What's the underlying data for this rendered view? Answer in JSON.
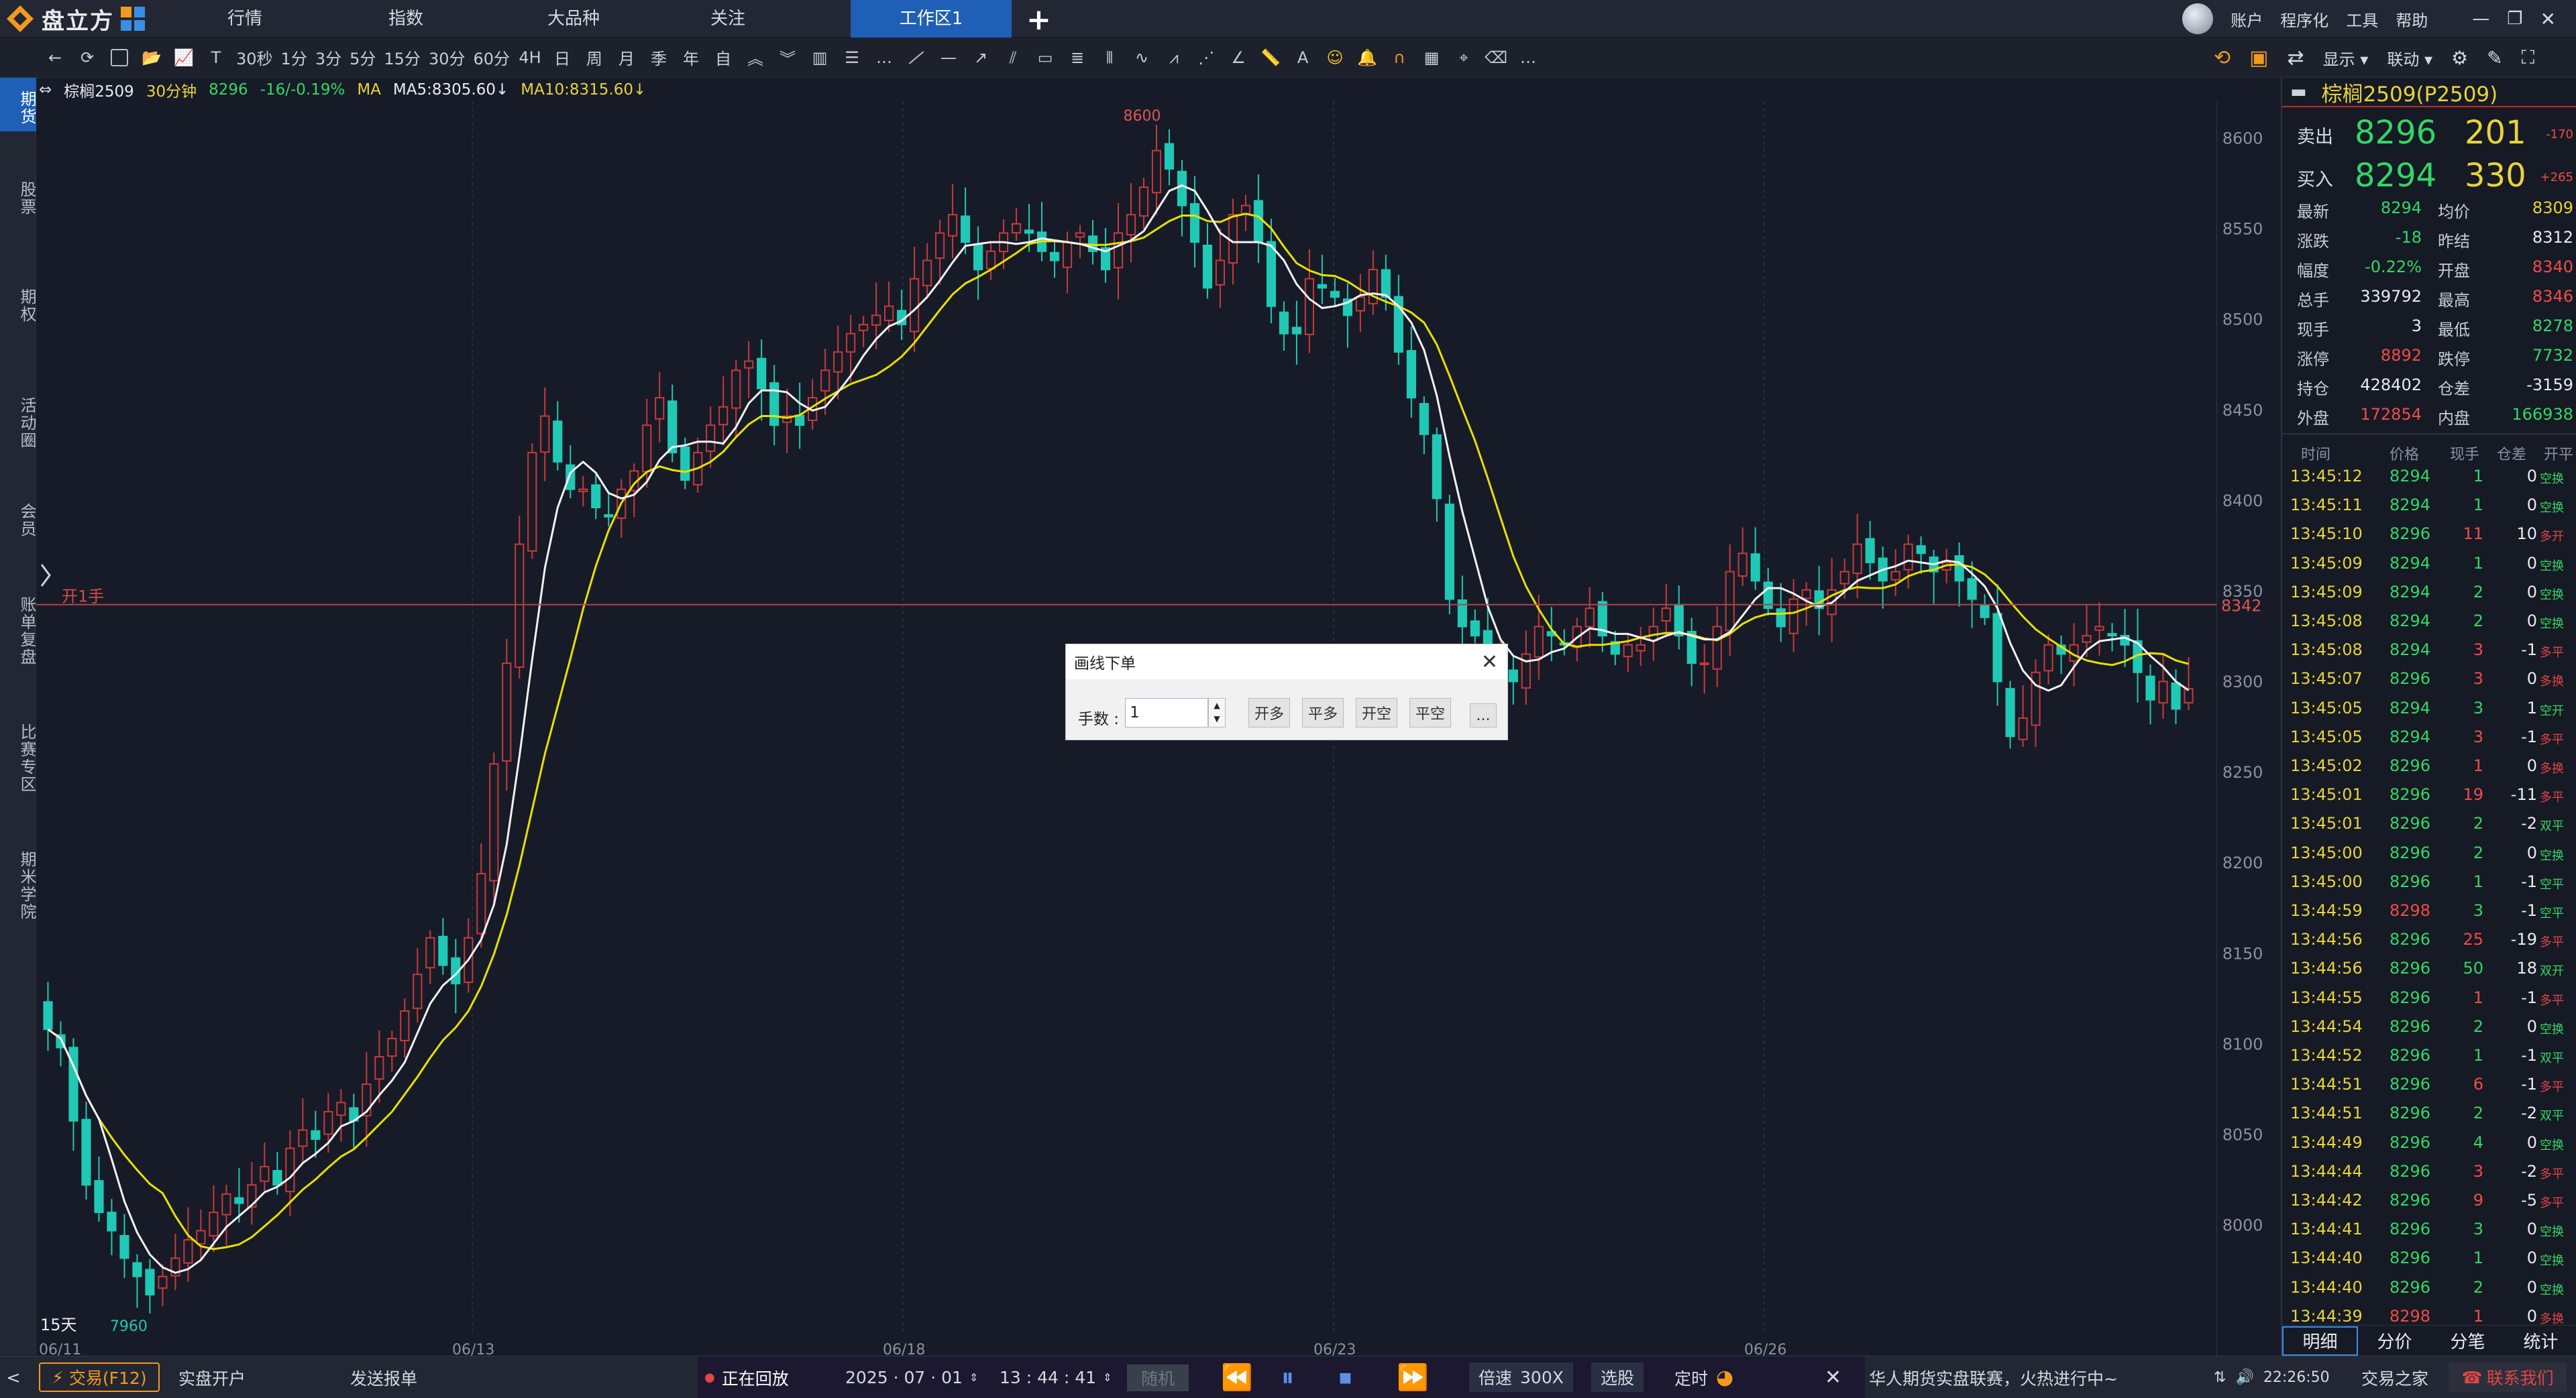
{
  "app": {
    "logo_text": "盘立方"
  },
  "nav": {
    "tabs": [
      "行情",
      "指数",
      "大品种",
      "关注",
      "工作区1"
    ],
    "right": [
      "账户",
      "程序化",
      "工具",
      "帮助"
    ]
  },
  "toolbar": {
    "periods": [
      "30秒",
      "1分",
      "3分",
      "5分",
      "15分",
      "30分",
      "60分",
      "4H",
      "日",
      "周",
      "月",
      "季",
      "年",
      "自"
    ]
  },
  "sidebar": {
    "items": [
      "期货",
      "股票",
      "期权",
      "活动圈",
      "会员",
      "账单复盘",
      "比赛专区",
      "期米学院"
    ]
  },
  "chartinfo": {
    "symbol": "棕榈2509",
    "period": "30分钟",
    "price": "8296",
    "change": "-16/-0.19%",
    "ma_label": "MA",
    "ma5": "MA5:8305.60↓",
    "ma10": "MA10:8315.60↓"
  },
  "chart": {
    "ylabels": [
      "8600",
      "8550",
      "8500",
      "8450",
      "8400",
      "8350",
      "8300",
      "8250",
      "8200",
      "8150",
      "8100",
      "8050",
      "8000"
    ],
    "xlabels": [
      "06/11",
      "06/13",
      "06/18",
      "06/23",
      "06/26"
    ],
    "high_label": "8600",
    "low_label": "7960",
    "hline_label": "8342",
    "order_label": "开1手",
    "days_label": "15天"
  },
  "chart_data": {
    "type": "candlestick",
    "ylim": [
      7950,
      8610
    ],
    "close": [
      8110,
      8100,
      8060,
      8025,
      8010,
      8000,
      7985,
      7975,
      7965,
      7975,
      7985,
      7995,
      8000,
      8010,
      8020,
      8015,
      8025,
      8035,
      8025,
      8045,
      8055,
      8050,
      8065,
      8070,
      8060,
      8080,
      8095,
      8105,
      8120,
      8140,
      8160,
      8145,
      8135,
      8160,
      8195,
      8255,
      8310,
      8375,
      8425,
      8445,
      8420,
      8405,
      8405,
      8395,
      8390,
      8405,
      8415,
      8440,
      8455,
      8425,
      8410,
      8425,
      8440,
      8450,
      8470,
      8475,
      8460,
      8440,
      8445,
      8440,
      8455,
      8470,
      8480,
      8490,
      8495,
      8500,
      8505,
      8495,
      8520,
      8530,
      8545,
      8555,
      8540,
      8525,
      8535,
      8545,
      8550,
      8545,
      8535,
      8530,
      8540,
      8545,
      8535,
      8525,
      8545,
      8555,
      8570,
      8590,
      8580,
      8560,
      8540,
      8515,
      8530,
      8555,
      8560,
      8540,
      8505,
      8490,
      8490,
      8520,
      8515,
      8510,
      8500,
      8510,
      8525,
      8510,
      8480,
      8455,
      8435,
      8400,
      8345,
      8330,
      8325,
      8305,
      8310,
      8300,
      8315,
      8330,
      8325,
      8320,
      8330,
      8340,
      8325,
      8315,
      8320,
      8320,
      8330,
      8340,
      8325,
      8310,
      8310,
      8330,
      8360,
      8370,
      8355,
      8340,
      8330,
      8345,
      8350,
      8340,
      8350,
      8360,
      8375,
      8365,
      8355,
      8360,
      8375,
      8370,
      8360,
      8365,
      8355,
      8345,
      8335,
      8300,
      8270,
      8280,
      8305,
      8320,
      8315,
      8320,
      8325,
      8330,
      8325,
      8320,
      8305,
      8290,
      8300,
      8285,
      8296
    ],
    "ma5": "MA5:8305.60",
    "ma10": "MA10:8315.60"
  },
  "quote": {
    "title": "棕榈2509(P2509)",
    "sell": {
      "label": "卖出",
      "price": "8296",
      "vol": "201",
      "chg": "-170"
    },
    "buy": {
      "label": "买入",
      "price": "8294",
      "vol": "330",
      "chg": "+265"
    },
    "rows": [
      {
        "l1": "最新",
        "v1": "8294",
        "l2": "均价",
        "v2": "8309",
        "c1": "green",
        "c2": "yellow"
      },
      {
        "l1": "涨跌",
        "v1": "-18",
        "l2": "昨结",
        "v2": "8312",
        "c1": "green",
        "c2": "white"
      },
      {
        "l1": "幅度",
        "v1": "-0.22%",
        "l2": "开盘",
        "v2": "8340",
        "c1": "green",
        "c2": "red"
      },
      {
        "l1": "总手",
        "v1": "339792",
        "l2": "最高",
        "v2": "8346",
        "c1": "white",
        "c2": "red"
      },
      {
        "l1": "现手",
        "v1": "3",
        "l2": "最低",
        "v2": "8278",
        "c1": "white",
        "c2": "green"
      },
      {
        "l1": "涨停",
        "v1": "8892",
        "l2": "跌停",
        "v2": "7732",
        "c1": "red",
        "c2": "green"
      },
      {
        "l1": "持仓",
        "v1": "428402",
        "l2": "仓差",
        "v2": "-3159",
        "c1": "white",
        "c2": "white"
      },
      {
        "l1": "外盘",
        "v1": "172854",
        "l2": "内盘",
        "v2": "166938",
        "c1": "red",
        "c2": "green"
      }
    ]
  },
  "trades": {
    "headers": [
      "时间",
      "价格",
      "现手",
      "仓差",
      "开平"
    ],
    "rows": [
      [
        "13:45:12",
        "8294",
        "1",
        "0",
        "空换"
      ],
      [
        "13:45:11",
        "8294",
        "1",
        "0",
        "空换"
      ],
      [
        "13:45:10",
        "8296",
        "11",
        "10",
        "多开"
      ],
      [
        "13:45:09",
        "8294",
        "1",
        "0",
        "空换"
      ],
      [
        "13:45:09",
        "8294",
        "2",
        "0",
        "空换"
      ],
      [
        "13:45:08",
        "8294",
        "2",
        "0",
        "空换"
      ],
      [
        "13:45:08",
        "8294",
        "3",
        "-1",
        "多平"
      ],
      [
        "13:45:07",
        "8296",
        "3",
        "0",
        "多换"
      ],
      [
        "13:45:05",
        "8294",
        "3",
        "1",
        "空开"
      ],
      [
        "13:45:05",
        "8294",
        "3",
        "-1",
        "多平"
      ],
      [
        "13:45:02",
        "8296",
        "1",
        "0",
        "多换"
      ],
      [
        "13:45:01",
        "8296",
        "19",
        "-11",
        "多平"
      ],
      [
        "13:45:01",
        "8296",
        "2",
        "-2",
        "双平"
      ],
      [
        "13:45:00",
        "8296",
        "2",
        "0",
        "空换"
      ],
      [
        "13:45:00",
        "8296",
        "1",
        "-1",
        "空平"
      ],
      [
        "13:44:59",
        "8298",
        "3",
        "-1",
        "空平"
      ],
      [
        "13:44:56",
        "8296",
        "25",
        "-19",
        "多平"
      ],
      [
        "13:44:56",
        "8296",
        "50",
        "18",
        "双开"
      ],
      [
        "13:44:55",
        "8296",
        "1",
        "-1",
        "多平"
      ],
      [
        "13:44:54",
        "8296",
        "2",
        "0",
        "空换"
      ],
      [
        "13:44:52",
        "8296",
        "1",
        "-1",
        "双平"
      ],
      [
        "13:44:51",
        "8296",
        "6",
        "-1",
        "多平"
      ],
      [
        "13:44:51",
        "8296",
        "2",
        "-2",
        "双平"
      ],
      [
        "13:44:49",
        "8296",
        "4",
        "0",
        "空换"
      ],
      [
        "13:44:44",
        "8296",
        "3",
        "-2",
        "多平"
      ],
      [
        "13:44:42",
        "8296",
        "9",
        "-5",
        "多平"
      ],
      [
        "13:44:41",
        "8296",
        "3",
        "0",
        "空换"
      ],
      [
        "13:44:40",
        "8296",
        "1",
        "0",
        "空换"
      ],
      [
        "13:44:40",
        "8296",
        "2",
        "0",
        "空换"
      ],
      [
        "13:44:39",
        "8298",
        "1",
        "0",
        "多换"
      ]
    ],
    "tabs": [
      "明细",
      "分价",
      "分笔",
      "统计"
    ]
  },
  "dialog": {
    "title": "画线下单",
    "qty_label": "手数 :",
    "qty_value": "1",
    "buttons": [
      "开多",
      "平多",
      "开空",
      "平空",
      "..."
    ]
  },
  "bottom": {
    "trade": "交易(F12)",
    "open_account": "实盘开户",
    "send_order": "发送报单",
    "replay": "正在回放",
    "date": "2025 · 07 · 01",
    "time": "13 : 44 : 41",
    "random": "随机",
    "speed_label": "倍速",
    "speed": "300X",
    "pick": "选股",
    "timer": "定时",
    "ticker": "华人期货实盘联赛，火热进行中~",
    "clock": "22:26:50",
    "trade_home": "交易之家",
    "contact": "联系我们"
  }
}
